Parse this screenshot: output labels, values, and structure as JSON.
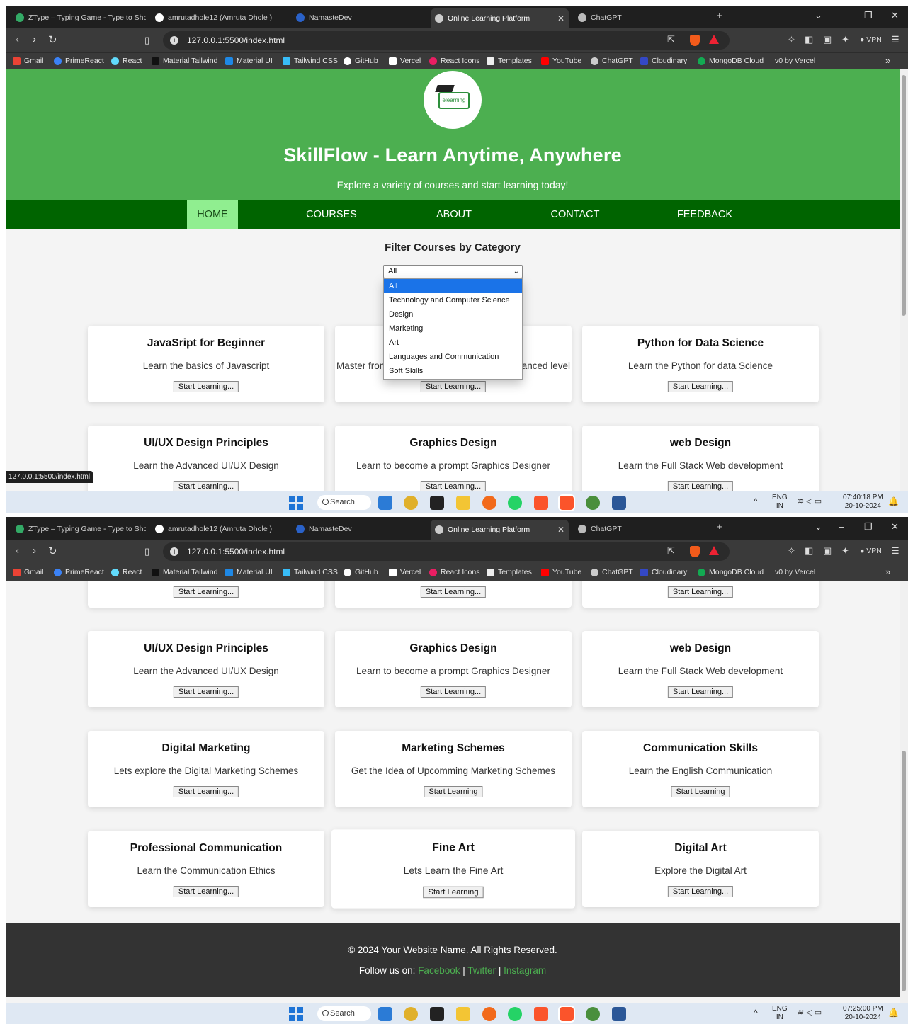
{
  "browser": {
    "tabs": [
      "ZType – Typing Game - Type to Sho",
      "amrutadhole12 (Amruta Dhole )",
      "NamasteDev",
      "Online Learning Platform",
      "ChatGPT"
    ],
    "new_tab": "+",
    "url": "127.0.0.1:5500/index.html",
    "vpn": "VPN",
    "bookmarks": [
      "Gmail",
      "PrimeReact",
      "React",
      "Material Tailwind",
      "Material UI",
      "Tailwind CSS",
      "GitHub",
      "Vercel",
      "React Icons",
      "Templates",
      "YouTube",
      "ChatGPT",
      "Cloudinary",
      "MongoDB Cloud",
      "v0 by Vercel"
    ],
    "more": "»"
  },
  "site": {
    "logo_text": "elearning",
    "title": "SkillFlow - Learn Anytime, Anywhere",
    "subtitle": "Explore a variety of courses and start learning today!",
    "nav": [
      "HOME",
      "COURSES",
      "ABOUT",
      "CONTACT",
      "FEEDBACK"
    ],
    "filter_title": "Filter Courses by Category",
    "filter_selected": "All",
    "filter_options": [
      "All",
      "Technology and Computer Science",
      "Design",
      "Marketing",
      "Art",
      "Languages and Communication",
      "Soft Skills"
    ],
    "courses": [
      {
        "title": "JavaSript for Beginner",
        "desc": "Learn the basics of Javascript",
        "button": "Start Learning..."
      },
      {
        "title": "",
        "desc": "Master from ... anced level",
        "button": "Start Learning..."
      },
      {
        "title": "Python for Data Science",
        "desc": "Learn the Python for data Science",
        "button": "Start Learning..."
      },
      {
        "title": "UI/UX Design Principles",
        "desc": "Learn the Advanced UI/UX Design",
        "button": "Start Learning..."
      },
      {
        "title": "Graphics Design",
        "desc": "Learn to become a prompt Graphics Designer",
        "button": "Start Learning..."
      },
      {
        "title": "web Design",
        "desc": "Learn the Full Stack Web development",
        "button": "Start Learning..."
      },
      {
        "title": "Digital Marketing",
        "desc": "Lets explore the Digital Marketing Schemes",
        "button": "Start Learning..."
      },
      {
        "title": "Marketing Schemes",
        "desc": "Get the Idea of Upcomming Marketing Schemes",
        "button": "Start Learning"
      },
      {
        "title": "Communication Skills",
        "desc": "Learn the English Communication",
        "button": "Start Learning"
      },
      {
        "title": "Professional Communication",
        "desc": "Learn the Communication Ethics",
        "button": "Start Learning..."
      },
      {
        "title": "Fine Art",
        "desc": "Lets Learn the Fine Art",
        "button": "Start Learning"
      },
      {
        "title": "Digital Art",
        "desc": "Explore the Digital Art",
        "button": "Start Learning..."
      }
    ],
    "partial_desc_left": "Master fron",
    "partial_desc_right": "anced level",
    "footer_copy": "© 2024 Your Website Name. All Rights Reserved.",
    "footer_follow": "Follow us on:",
    "footer_links": [
      "Facebook",
      "Twitter",
      "Instagram"
    ],
    "footer_sep": "|",
    "status_url": "127.0.0.1:5500/index.html"
  },
  "taskbar": {
    "search": "Search",
    "lang1": "ENG",
    "lang2": "IN",
    "time1": "07:40:18 PM",
    "date1": "20-10-2024",
    "time2": "07:25:00 PM",
    "date2": "20-10-2024"
  },
  "colors": {
    "hero": "#4caf50",
    "navbar": "#006400",
    "nav_active": "#90ee90",
    "footer": "#333333",
    "link": "#4caf50"
  }
}
